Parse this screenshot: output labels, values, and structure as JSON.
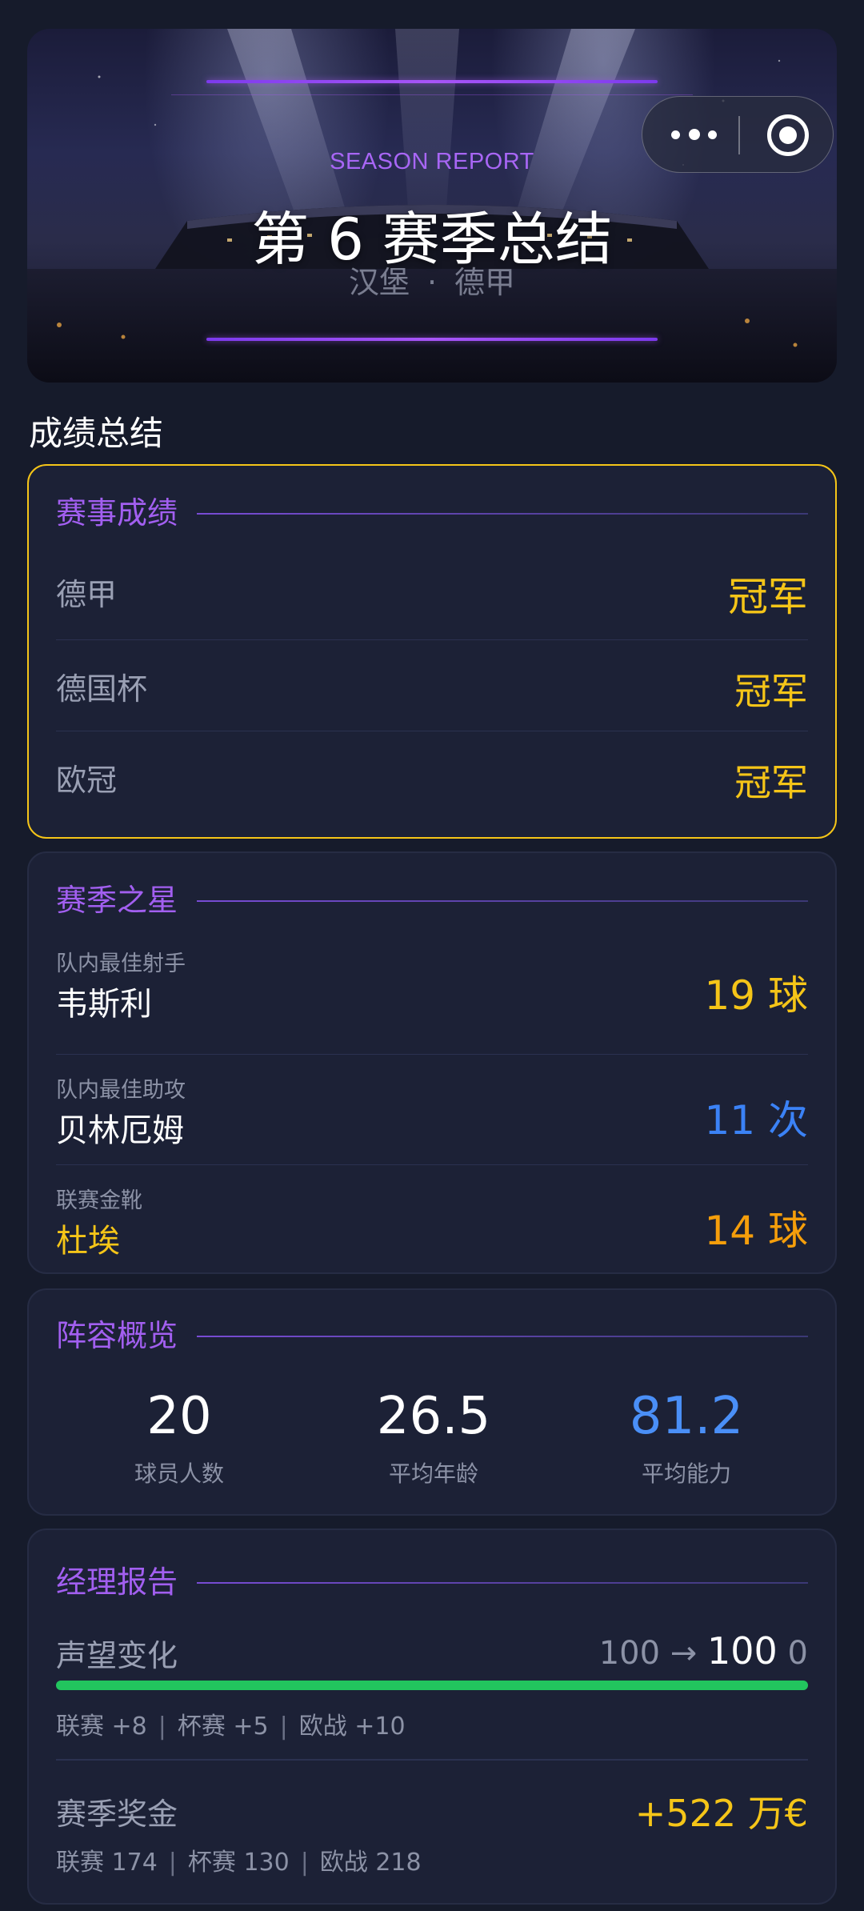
{
  "hero": {
    "kicker": "SEASON REPORT",
    "title": "第 6 赛季总结",
    "team": "汉堡",
    "league": "德甲",
    "separator": "·"
  },
  "section_title": "成绩总结",
  "results": {
    "heading": "赛事成绩",
    "rows": [
      {
        "competition": "德甲",
        "result": "冠军"
      },
      {
        "competition": "德国杯",
        "result": "冠军"
      },
      {
        "competition": "欧冠",
        "result": "冠军"
      }
    ]
  },
  "stars": {
    "heading": "赛季之星",
    "rows": [
      {
        "caption": "队内最佳射手",
        "name": "韦斯利",
        "value": "19 球",
        "color": "#f5c518"
      },
      {
        "caption": "队内最佳助攻",
        "name": "贝林厄姆",
        "value": "11 次",
        "color": "#3b82f6"
      },
      {
        "caption": "联赛金靴",
        "name": "杜埃",
        "value": "14 球",
        "color": "#f59e0b"
      }
    ]
  },
  "squad": {
    "heading": "阵容概览",
    "stats": [
      {
        "value": "20",
        "label": "球员人数"
      },
      {
        "value": "26.5",
        "label": "平均年龄"
      },
      {
        "value": "81.2",
        "label": "平均能力"
      }
    ]
  },
  "manager": {
    "heading": "经理报告",
    "reputation": {
      "label": "声望变化",
      "from": "100",
      "arrow": "→",
      "to": "100",
      "delta": "0",
      "progress": 1.0,
      "breakdown": [
        "联赛 +8",
        "杯赛 +5",
        "欧战 +10"
      ]
    },
    "prize": {
      "label": "赛季奖金",
      "value": "+522 万€",
      "breakdown": [
        "联赛 174",
        "杯赛 130",
        "欧战 218"
      ]
    },
    "breakdown_separator": "|"
  },
  "capsule": {
    "more_icon": "more-dots-icon",
    "close_icon": "target-close-icon"
  },
  "colors": {
    "accent": "#a25ff0",
    "gold": "#f5c518",
    "blue": "#3b82f6",
    "green": "#22c55e"
  }
}
